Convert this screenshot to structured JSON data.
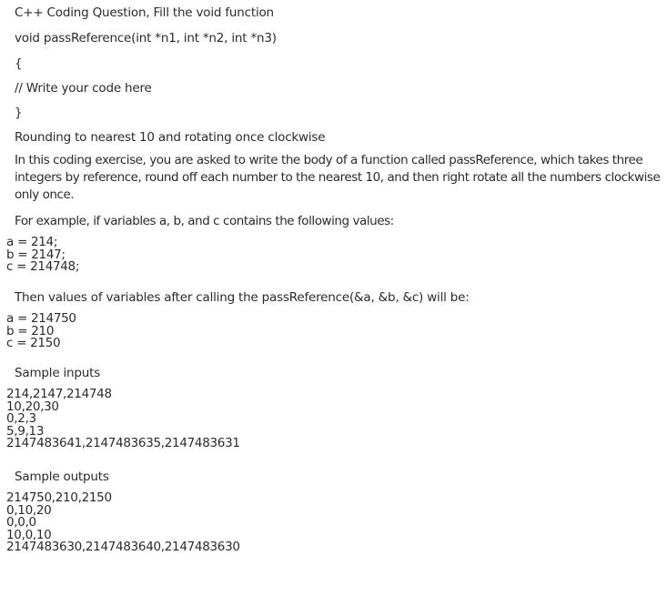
{
  "question": {
    "title": "C++ Coding Question, Fill the void function",
    "signature": "void passReference(int *n1, int *n2, int *n3)",
    "open_brace": "{",
    "comment": "// Write your code here",
    "close_brace": "}",
    "heading": "Rounding to nearest 10 and rotating once clockwise",
    "description": "In this coding exercise, you are asked to write the body of a function called passReference, which takes three integers by reference, round off each number to the nearest 10, and then right rotate all the numbers clockwise only once.",
    "example_intro": "For example, if variables a, b, and c contains the following values:",
    "example_inputs": [
      "a = 214;",
      "b = 2147;",
      "c = 214748;"
    ],
    "example_result_intro": "Then values of variables after calling the passReference(&a, &b, &c) will be:",
    "example_outputs": [
      "a = 214750",
      "b = 210",
      "c = 2150"
    ],
    "sample_inputs_label": "Sample inputs",
    "sample_inputs": [
      "214,2147,214748",
      "10,20,30",
      "0,2,3",
      "5,9,13",
      "2147483641,2147483635,2147483631"
    ],
    "sample_outputs_label": "Sample outputs",
    "sample_outputs": [
      "214750,210,2150",
      "0,10,20",
      "0,0,0",
      "10,0,10",
      "2147483630,2147483640,2147483630"
    ]
  }
}
